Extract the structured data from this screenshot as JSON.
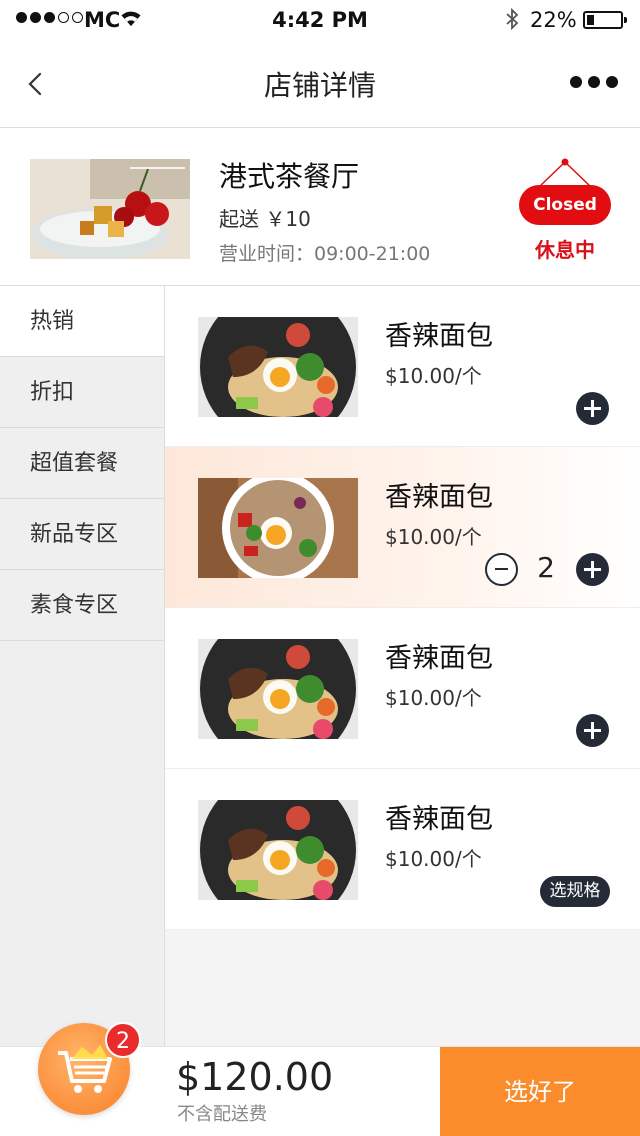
{
  "status_bar": {
    "carrier": "MC",
    "time": "4:42 PM",
    "battery": "22%",
    "battery_level": 0.22
  },
  "nav": {
    "title": "店铺详情"
  },
  "shop": {
    "name": "港式茶餐厅",
    "min_order": "起送 ￥10",
    "hours": "营业时间：09:00-21:00",
    "closed_badge": "Closed",
    "closed_text": "休息中"
  },
  "categories": [
    {
      "label": "热销"
    },
    {
      "label": "折扣"
    },
    {
      "label": "超值套餐"
    },
    {
      "label": "新品专区"
    },
    {
      "label": "素食专区"
    }
  ],
  "products": [
    {
      "name": "香辣面包",
      "price": "$10.00/个"
    },
    {
      "name": "香辣面包",
      "price": "$10.00/个",
      "qty_minus": "-",
      "quantity": "2"
    },
    {
      "name": "香辣面包",
      "price": "$10.00/个"
    },
    {
      "name": "香辣面包",
      "price": "$10.00/个",
      "spec_label": "选规格"
    }
  ],
  "cart": {
    "count": "2",
    "total": "$120.00",
    "note": "不含配送费",
    "checkout_label": "选好了"
  },
  "colors": {
    "accent": "#fb8c2c",
    "closed": "#e10d10",
    "dark_button": "#242a36",
    "badge": "#e92b2b"
  }
}
